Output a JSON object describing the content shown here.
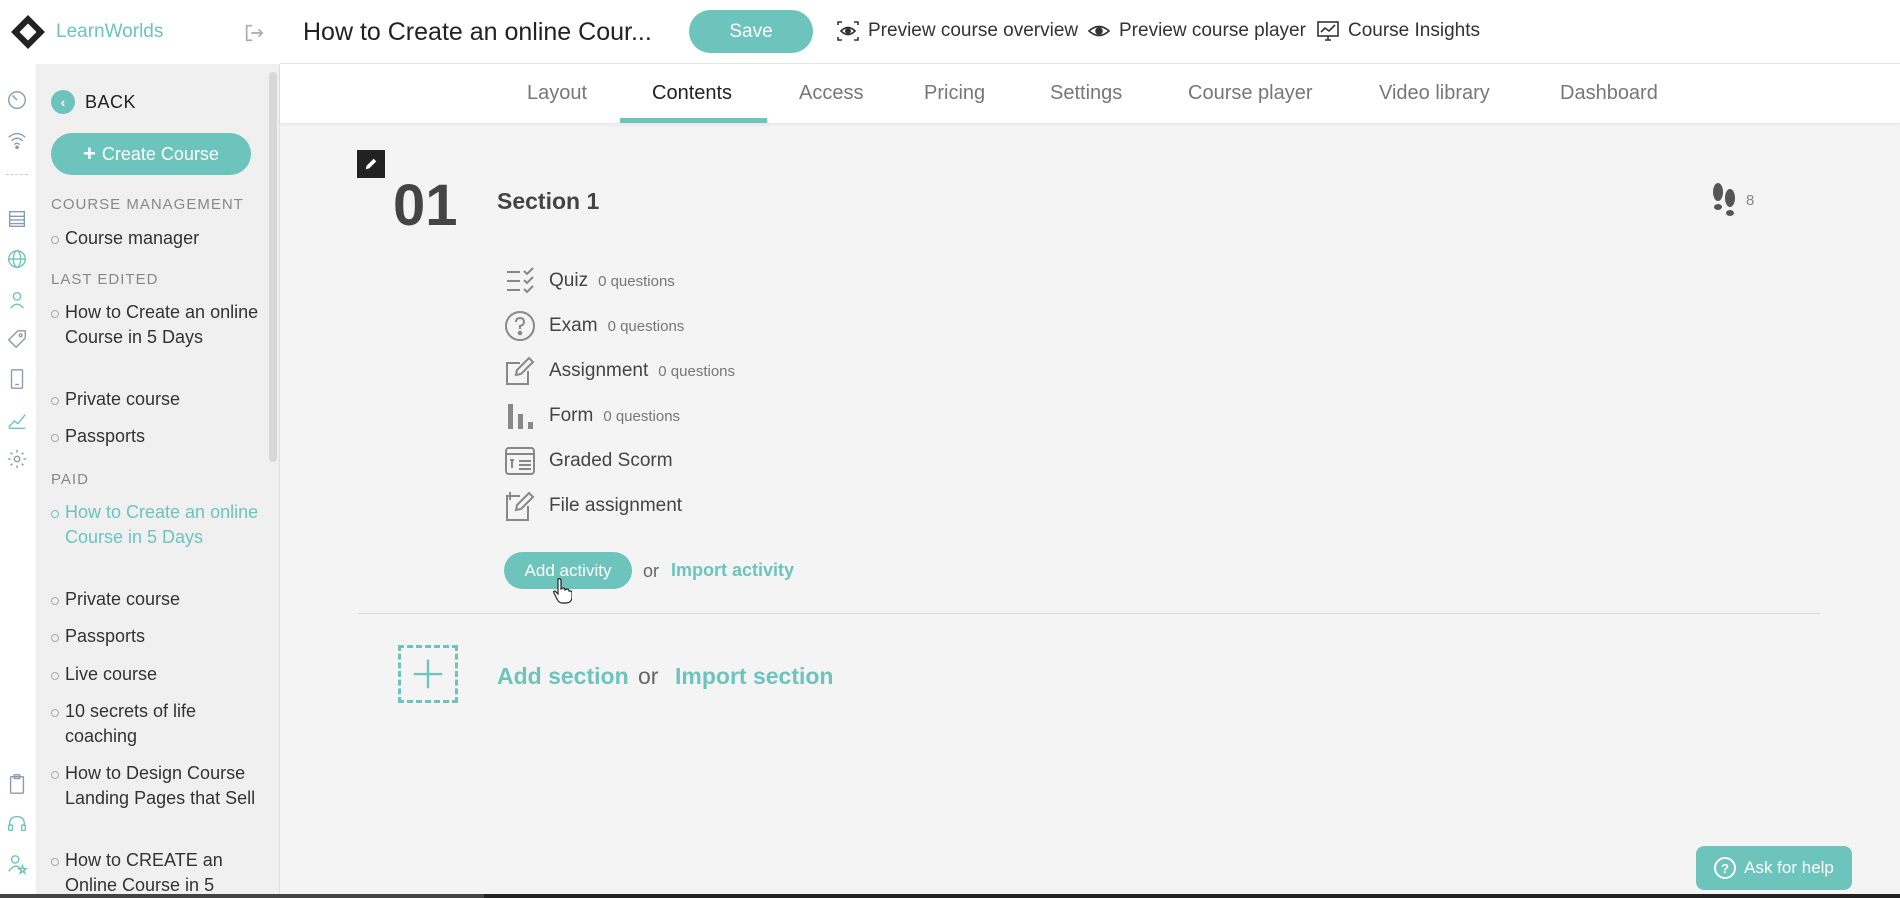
{
  "brand": {
    "name": "LearnWorlds",
    "accent": "#6cc4bd"
  },
  "header": {
    "course_title": "How to Create an online Cour...",
    "save_label": "Save",
    "links": [
      {
        "label": "Preview course overview",
        "icon": "eye-frame-icon"
      },
      {
        "label": "Preview course player",
        "icon": "eye-icon"
      },
      {
        "label": "Course Insights",
        "icon": "monitor-chart-icon"
      }
    ]
  },
  "tabs": [
    {
      "label": "Layout"
    },
    {
      "label": "Contents",
      "active": true
    },
    {
      "label": "Access"
    },
    {
      "label": "Pricing"
    },
    {
      "label": "Settings"
    },
    {
      "label": "Course player"
    },
    {
      "label": "Video library"
    },
    {
      "label": "Dashboard"
    }
  ],
  "sidebar": {
    "back_label": "BACK",
    "create_course_label": "Create Course",
    "groups": [
      {
        "title": "COURSE MANAGEMENT",
        "items": [
          "Course manager"
        ]
      },
      {
        "title": "LAST EDITED",
        "items": [
          "How to Create an online Course in 5 Days",
          "Private course",
          "Passports"
        ]
      },
      {
        "title": "PAID",
        "items": [
          "How to Create an online Course in 5 Days",
          "Private course",
          "Passports",
          "Live course",
          "10 secrets of life coaching",
          "How to Design Course Landing Pages that Sell",
          "How to CREATE an Online Course in 5"
        ]
      }
    ]
  },
  "section": {
    "number": "01",
    "title": "Section 1",
    "steps_count": "8",
    "activities": [
      {
        "name": "Quiz",
        "count": "0 questions",
        "icon": "quiz-list-icon"
      },
      {
        "name": "Exam",
        "count": "0 questions",
        "icon": "question-circle-icon"
      },
      {
        "name": "Assignment",
        "count": "0 questions",
        "icon": "pencil-square-icon"
      },
      {
        "name": "Form",
        "count": "0 questions",
        "icon": "bar-chart-icon"
      },
      {
        "name": "Graded Scorm",
        "count": "",
        "icon": "scorm-icon"
      },
      {
        "name": "File assignment",
        "count": "",
        "icon": "file-pencil-icon"
      }
    ],
    "add_activity_label": "Add activity",
    "or_label": "or",
    "import_activity_label": "Import activity"
  },
  "add_section": {
    "add_label": "Add section",
    "or_label": "or",
    "import_label": "Import section"
  },
  "help": {
    "label": "Ask for help"
  }
}
